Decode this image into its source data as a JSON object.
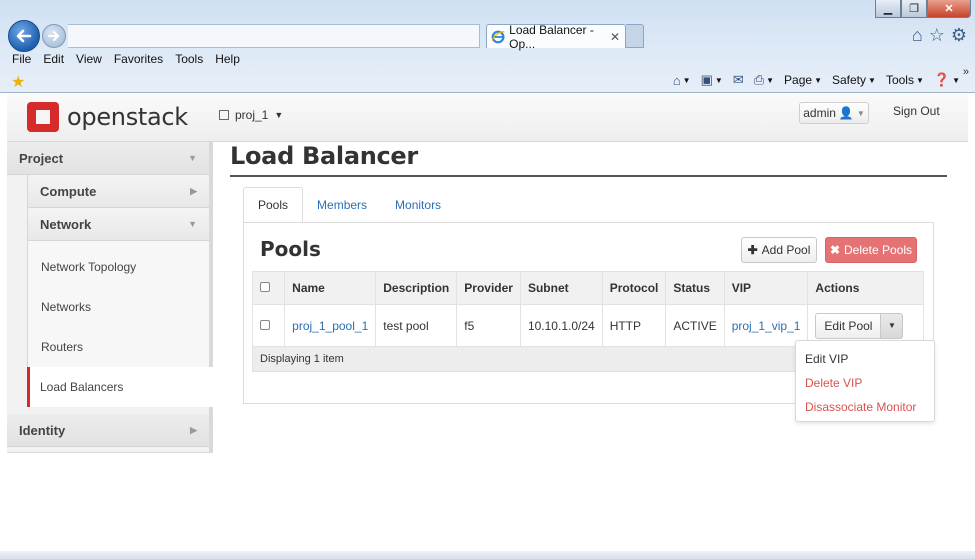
{
  "browser": {
    "tab_title": "Load Balancer - Op...",
    "menu": [
      "File",
      "Edit",
      "View",
      "Favorites",
      "Tools",
      "Help"
    ],
    "commands": {
      "page": "Page",
      "safety": "Safety",
      "tools": "Tools"
    }
  },
  "header": {
    "logo_text": "openstack",
    "project": "proj_1",
    "user": "admin",
    "sign_out": "Sign Out"
  },
  "sidebar": {
    "project": "Project",
    "compute": "Compute",
    "network": "Network",
    "links": [
      "Network Topology",
      "Networks",
      "Routers",
      "Load Balancers"
    ],
    "identity": "Identity"
  },
  "main": {
    "title": "Load Balancer",
    "tabs": [
      "Pools",
      "Members",
      "Monitors"
    ],
    "section_title": "Pools",
    "add_pool": "Add Pool",
    "delete_pools": "Delete Pools",
    "columns": [
      "Name",
      "Description",
      "Provider",
      "Subnet",
      "Protocol",
      "Status",
      "VIP",
      "Actions"
    ],
    "rows": [
      {
        "name": "proj_1_pool_1",
        "description": "test pool",
        "provider": "f5",
        "subnet": "10.10.1.0/24",
        "protocol": "HTTP",
        "status": "ACTIVE",
        "vip": "proj_1_vip_1",
        "action": "Edit Pool"
      }
    ],
    "footer": "Displaying 1 item",
    "dropdown": [
      "Edit VIP",
      "Delete VIP",
      "Disassociate Monitor"
    ]
  },
  "colors": {
    "accent_red": "#d62b2b",
    "link_blue": "#2a6fb5",
    "danger": "#d9534f"
  }
}
